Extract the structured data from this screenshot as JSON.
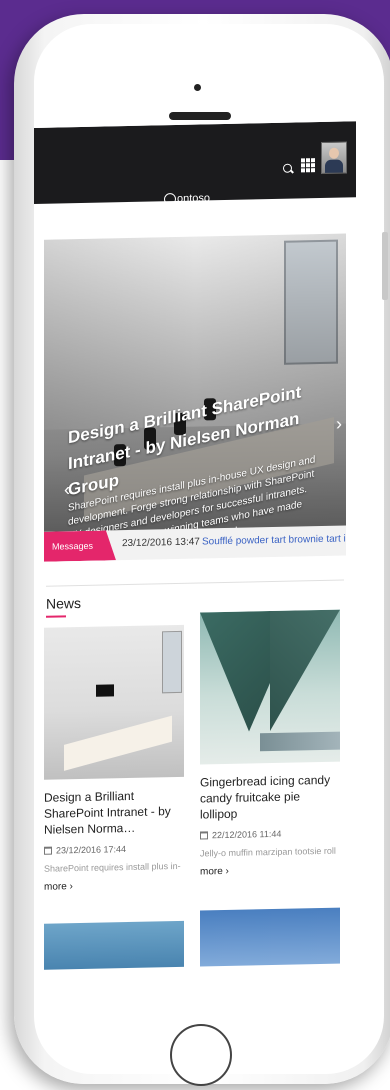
{
  "header": {
    "logo_text": "ontoso"
  },
  "hero": {
    "title": "Design a Brilliant SharePoint Intranet - by Nielsen Norman Group",
    "text": "SharePoint requires install plus in-house UX design and development. Forge strong relationship with SharePoint UX designers and developers for successful intranets. And take advice from winning teams who have made SharePoint an effective enterprise tool.",
    "prev_label": "‹",
    "next_label": "›"
  },
  "messages": {
    "badge": "Messages",
    "date": "23/12/2016 13:47",
    "text": "Soufflé powder tart brownie tart ic"
  },
  "news": {
    "title": "News",
    "cards": [
      {
        "title": "Design a Brilliant SharePoint Intranet - by Nielsen Norma…",
        "date": "23/12/2016 17:44",
        "text": "SharePoint requires install plus in-",
        "more": "more ›"
      },
      {
        "title": "Gingerbread icing candy candy fruitcake pie lollipop",
        "date": "22/12/2016 11:44",
        "text": "Jelly-o muffin marzipan tootsie roll",
        "more": "more ›"
      }
    ]
  },
  "colors": {
    "accent": "#e4266b",
    "link": "#3b63c4",
    "header_bg": "#1b1b1d",
    "brand_band": "#5b2c8f"
  }
}
